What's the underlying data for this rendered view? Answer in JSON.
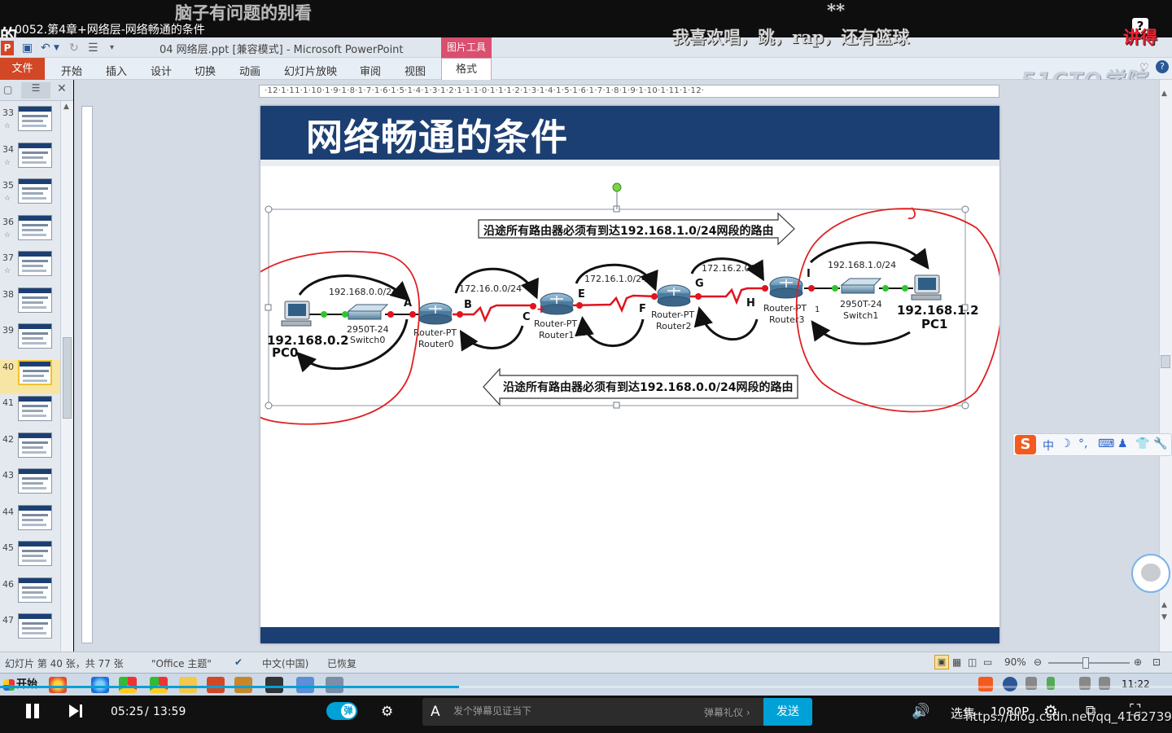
{
  "video": {
    "title": "0052.第4章+网络层-网络畅通的条件",
    "danmaku": [
      "脑子有问题的别看",
      "的",
      "我喜欢唱，跳，rap，还有篮球",
      "**",
      "讲得"
    ],
    "progress": 0.3917,
    "time_current": "05:25",
    "time_separator": "/",
    "time_total": "13:59",
    "danmaku_toggle_label": "弹",
    "danmaku_placeholder": "发个弹幕见证当下",
    "danmaku_etiquette": "弹幕礼仪 ›",
    "send_label": "发送",
    "select_label": "选集",
    "quality_label": "1080P",
    "watermark": "https://blog.csdn.net/qq_41627390"
  },
  "ppt": {
    "doc_title": "04 网络层.ppt [兼容模式]  -  Microsoft PowerPoint",
    "picture_tools_label": "图片工具",
    "file_tab": "文件",
    "tabs": [
      "开始",
      "插入",
      "设计",
      "切换",
      "动画",
      "幻灯片放映",
      "审阅",
      "视图"
    ],
    "format_tab": "格式",
    "brand_watermark": "51CTO学院",
    "ruler": "·12·1·11·1·10·1·9·1·8·1·7·1·6·1·5·1·4·1·3·1·2·1·1·1·0·1·1·1·2·1·3·1·4·1·5·1·6·1·7·1·8·1·9·1·10·1·11·1·12·",
    "thumbnails": [
      {
        "num": "33",
        "star": "☆"
      },
      {
        "num": "34",
        "star": "☆"
      },
      {
        "num": "35",
        "star": "☆"
      },
      {
        "num": "36",
        "star": "☆"
      },
      {
        "num": "37",
        "star": "☆"
      },
      {
        "num": "38",
        "star": ""
      },
      {
        "num": "39",
        "star": ""
      },
      {
        "num": "40",
        "star": ""
      },
      {
        "num": "41",
        "star": ""
      },
      {
        "num": "42",
        "star": ""
      },
      {
        "num": "43",
        "star": ""
      },
      {
        "num": "44",
        "star": ""
      },
      {
        "num": "45",
        "star": ""
      },
      {
        "num": "46",
        "star": ""
      },
      {
        "num": "47",
        "star": ""
      }
    ],
    "selected_slide": "40",
    "status": {
      "slide_info": "幻灯片 第 40 张，共 77 张",
      "theme": "\"Office 主题\"",
      "language": "中文(中国)",
      "recovered": "已恢复",
      "zoom": "90%"
    },
    "clock": "11:22"
  },
  "slide": {
    "title": "网络畅通的条件",
    "arrow_top": "沿途所有路由器必须有到达192.168.1.0/24网段的路由",
    "arrow_bottom": "沿途所有路由器必须有到达192.168.0.0/24网段的路由",
    "networks": [
      "192.168.0.0/24",
      "172.16.0.0/24",
      "172.16.1.0/24",
      "172.16.2.0/24",
      "192.168.1.0/24"
    ],
    "points": [
      "A",
      "B",
      "C",
      "E",
      "F",
      "G",
      "H",
      "I"
    ],
    "devices": {
      "pc0_ip": "192.168.0.2",
      "pc0_name": "PC0",
      "switch0_model": "2950T-24",
      "switch0_name": "Switch0",
      "router0_model": "Router-PT",
      "router0_name": "Router0",
      "router1_model": "Router-PT",
      "router1_name": "Router1",
      "router2_model": "Router-PT",
      "router2_name": "Router2",
      "router3_model": "Router-PT",
      "router3_name": "Router3",
      "switch1_model": "2950T-24",
      "switch1_name": "Switch1",
      "pc1_ip": "192.168.1.2",
      "pc1_name": "PC1",
      "port_label": "1"
    }
  },
  "ime": {
    "items": [
      "中",
      "☽",
      "°,",
      "⌨",
      "♟",
      "👕",
      "🔧"
    ]
  },
  "colors": {
    "slide_header": "#1c3f73",
    "link_red": "#e0141e",
    "annotation_red": "#e02020",
    "video_accent": "#00a1d6"
  }
}
